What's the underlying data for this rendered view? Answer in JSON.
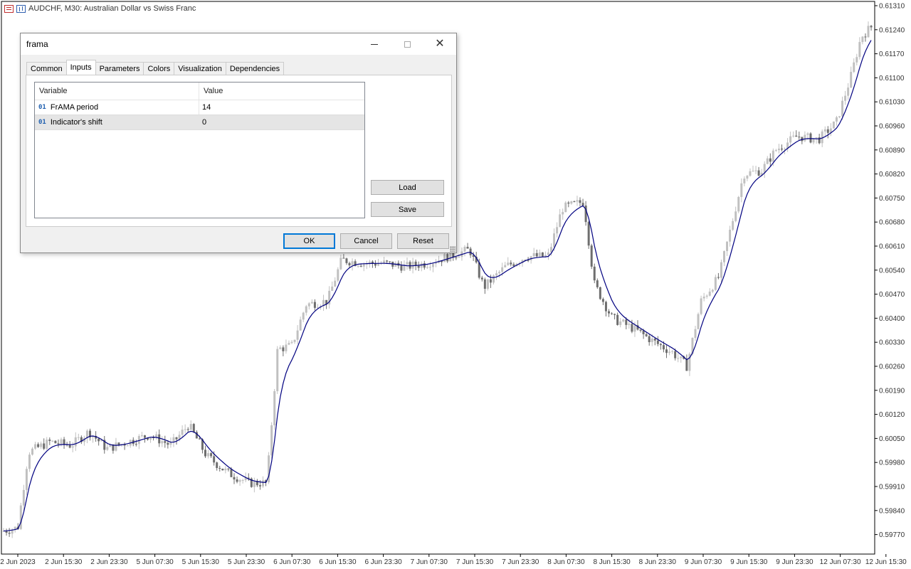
{
  "chart": {
    "header_text": "AUDCHF, M30:  Australian Dollar vs Swiss  Franc",
    "price_labels": [
      "0.61310",
      "0.61240",
      "0.61170",
      "0.61100",
      "0.61030",
      "0.60960",
      "0.60890",
      "0.60820",
      "0.60750",
      "0.60680",
      "0.60610",
      "0.60540",
      "0.60470",
      "0.60400",
      "0.60330",
      "0.60260",
      "0.60190",
      "0.60120",
      "0.60050",
      "0.59980",
      "0.59910",
      "0.59840",
      "0.59770"
    ],
    "time_labels": [
      "2 Jun 2023",
      "2 Jun 15:30",
      "2 Jun 23:30",
      "5 Jun 07:30",
      "5 Jun 15:30",
      "5 Jun 23:30",
      "6 Jun 07:30",
      "6 Jun 15:30",
      "6 Jun 23:30",
      "7 Jun 07:30",
      "7 Jun 15:30",
      "7 Jun 23:30",
      "8 Jun 07:30",
      "8 Jun 15:30",
      "8 Jun 23:30",
      "9 Jun 07:30",
      "9 Jun 15:30",
      "9 Jun 23:30",
      "12 Jun 07:30",
      "12 Jun 15:30"
    ],
    "colors": {
      "candle_up": "#c0c0c0",
      "candle_down": "#6e6e6e",
      "frama_line": "#000080",
      "axis": "#000000"
    }
  },
  "dialog": {
    "title": "frama",
    "tabs": [
      {
        "label": "Common"
      },
      {
        "label": "Inputs"
      },
      {
        "label": "Parameters"
      },
      {
        "label": "Colors"
      },
      {
        "label": "Visualization"
      },
      {
        "label": "Dependencies"
      }
    ],
    "active_tab": "Inputs",
    "table": {
      "headers": {
        "variable": "Variable",
        "value": "Value"
      },
      "rows": [
        {
          "type_icon": "01",
          "variable": "FrAMA period",
          "value": "14"
        },
        {
          "type_icon": "01",
          "variable": "Indicator's shift",
          "value": "0"
        }
      ]
    },
    "buttons": {
      "load": "Load",
      "save": "Save",
      "ok": "OK",
      "cancel": "Cancel",
      "reset": "Reset"
    },
    "window_controls": {
      "close_glyph": "✕"
    }
  }
}
